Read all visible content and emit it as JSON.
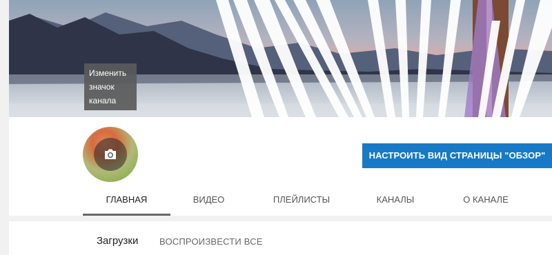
{
  "banner": {
    "tooltip_text": "Изменить значок канала"
  },
  "avatar": {
    "icon": "camera-icon"
  },
  "header": {
    "customize_button": "НАСТРОИТЬ ВИД СТРАНИЦЫ \"ОБЗОР\""
  },
  "tabs": [
    {
      "label": "ГЛАВНАЯ",
      "active": true
    },
    {
      "label": "ВИДЕО",
      "active": false
    },
    {
      "label": "ПЛЕЙЛИСТЫ",
      "active": false
    },
    {
      "label": "КАНАЛЫ",
      "active": false
    },
    {
      "label": "О КАНАЛЕ",
      "active": false
    }
  ],
  "section": {
    "title": "Загрузки",
    "play_all": "ВОСПРОИЗВЕСТИ ВСЕ"
  },
  "colors": {
    "accent_button": "#167ac6",
    "active_tab_underline": "#666666",
    "page_background": "#f1f1f1"
  }
}
